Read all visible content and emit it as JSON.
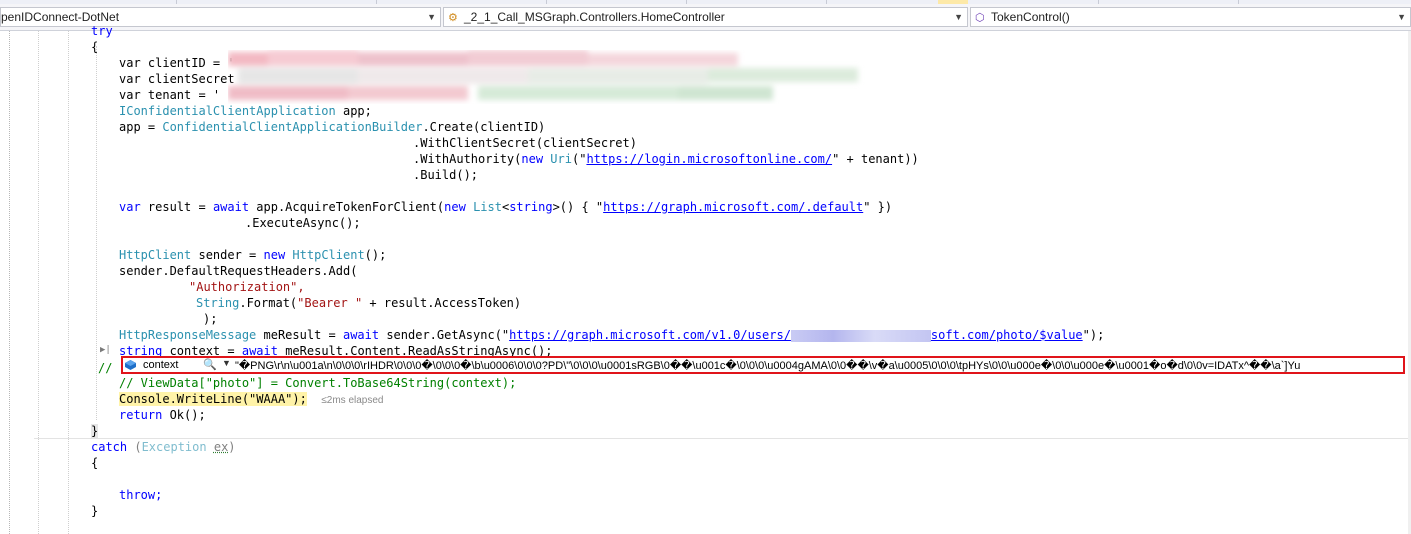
{
  "navbar": {
    "project": "penIDConnect-DotNet",
    "class": "_2_1_Call_MSGraph.Controllers.HomeController",
    "member": "TokenControl()"
  },
  "code": {
    "l_try": "try",
    "l_open1": "{",
    "l_clientid": "var clientID = '",
    "l_clientsecret": "var clientSecret",
    "l_tenant": "var tenant = '",
    "l_iconf_type": "IConfidentialClientApplication",
    "l_iconf_rest": " app;",
    "l_app_a": "app = ",
    "l_app_type": "ConfidentialClientApplicationBuilder",
    "l_app_b": ".Create(clientID)",
    "l_withsecret": ".WithClientSecret(clientSecret)",
    "l_withauth_a": ".WithAuthority(",
    "l_withauth_new": "new",
    "l_withauth_uri": "Uri",
    "l_withauth_b": "(\"",
    "l_withauth_url": "https://login.microsoftonline.com/",
    "l_withauth_c": "\" + tenant))",
    "l_build": ".Build();",
    "l_result_var": "var",
    "l_result_a": " result = ",
    "l_result_await": "await",
    "l_result_b": " app.AcquireTokenForClient(",
    "l_result_new": "new",
    "l_result_list": "List",
    "l_result_c": "<",
    "l_result_string": "string",
    "l_result_d": ">() { \"",
    "l_result_url": "https://graph.microsoft.com/.default",
    "l_result_e": "\" })",
    "l_execute": ".ExecuteAsync();",
    "l_http_type": "HttpClient",
    "l_http_a": " sender = ",
    "l_http_new": "new",
    "l_http_type2": "HttpClient",
    "l_http_b": "();",
    "l_headers": "sender.DefaultRequestHeaders.Add(",
    "l_auth": "\"Authorization\",",
    "l_format_type": "String",
    "l_format_a": ".Format(",
    "l_format_str": "\"Bearer \"",
    "l_format_b": " + result.AccessToken)",
    "l_close_paren": ");",
    "l_resp_type": "HttpResponseMessage",
    "l_resp_a": " meResult = ",
    "l_resp_await": "await",
    "l_resp_b": " sender.GetAsync(\"",
    "l_resp_url1": "https://graph.microsoft.com/v1.0/users/",
    "l_resp_url2": "soft.com/photo/$value",
    "l_resp_c": "\");",
    "l_ctx_string": "string",
    "l_ctx_a": " context = ",
    "l_ctx_await": "await",
    "l_ctx_b": " meResult.Content.ReadAsStringAsync();",
    "l_comment_mark": "//",
    "l_viewdata": "// ViewData[\"photo\"] = Convert.ToBase64String(context);",
    "l_console": "Console.WriteLine(\"WAAA\");",
    "l_elapsed": "≤2ms elapsed",
    "l_return_kw": "return",
    "l_return_b": " Ok();",
    "l_close1": "}",
    "l_catch_kw": "catch",
    "l_catch_a": " (",
    "l_catch_type": "Exception",
    "l_catch_b": " ",
    "l_catch_ex": "ex",
    "l_catch_c": ")",
    "l_open2": "{",
    "l_throw": "throw;",
    "l_close2": "}"
  },
  "datatip": {
    "name": "context",
    "value": "\"�PNG\\r\\n\\u001a\\n\\0\\0\\0\\rIHDR\\0\\0\\0�\\0\\0\\0�\\b\\u0006\\0\\0\\0?PD\\\"\\0\\0\\0\\u0001sRGB\\0��\\u001c�\\0\\0\\0\\u0004gAMA\\0\\0��\\v�a\\u0005\\0\\0\\0\\tpHYs\\0\\0\\u000e�\\0\\0\\u000e�\\u0001�o�d\\0\\0v=IDATx^��\\a`]Yu"
  },
  "colors": {
    "keyword": "#0000ff",
    "type": "#2b91af",
    "string": "#a31515",
    "comment": "#008000",
    "highlight": "#fff3a8",
    "datatip_border": "#e0141a"
  }
}
